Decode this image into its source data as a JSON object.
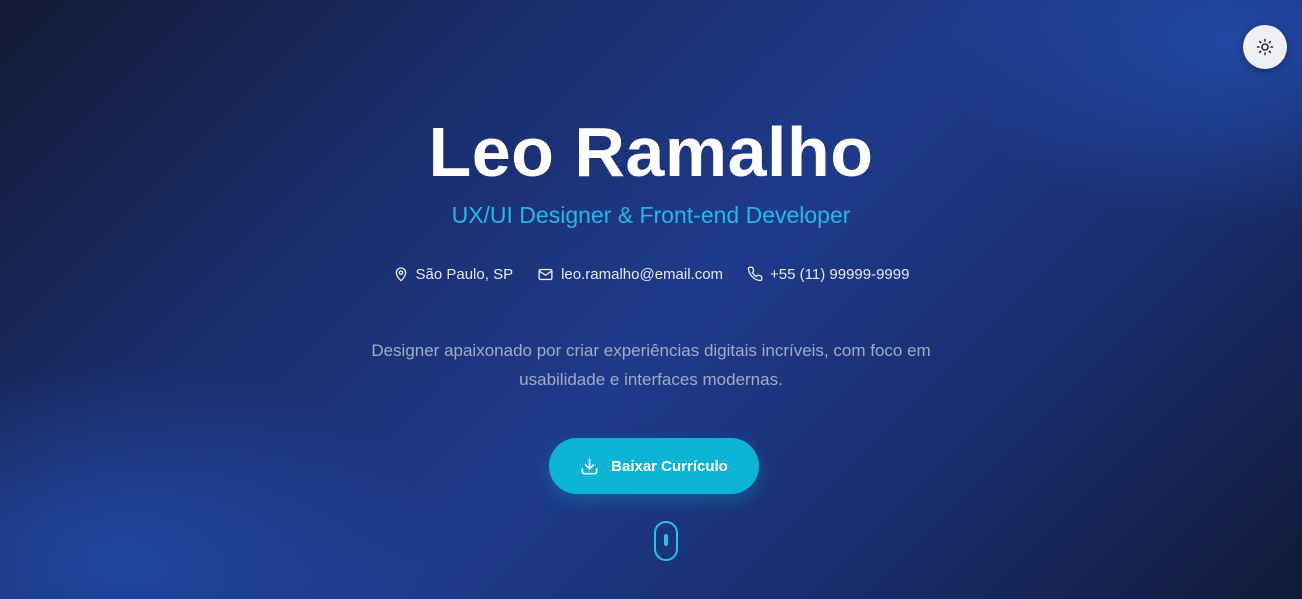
{
  "header": {
    "theme_toggle_icon": "sun-icon"
  },
  "hero": {
    "name": "Leo Ramalho",
    "role": "UX/UI Designer & Front-end Developer",
    "contacts": [
      {
        "icon": "map-pin-icon",
        "text": "São Paulo, SP"
      },
      {
        "icon": "mail-icon",
        "text": "leo.ramalho@email.com"
      },
      {
        "icon": "phone-icon",
        "text": "+55 (11) 99999-9999"
      }
    ],
    "bio": "Designer apaixonado por criar experiências digitais incríveis, com foco em usabilidade e interfaces modernas.",
    "cta": {
      "label": "Baixar Currículo",
      "icon": "download-icon"
    },
    "scroll_icon": "mouse-scroll-icon"
  },
  "colors": {
    "accent": "#22b8e8",
    "button": "#0eb4d6",
    "background_dark": "#131a35",
    "background_mid": "#1e3a8a",
    "text_muted": "#a3acc4"
  }
}
